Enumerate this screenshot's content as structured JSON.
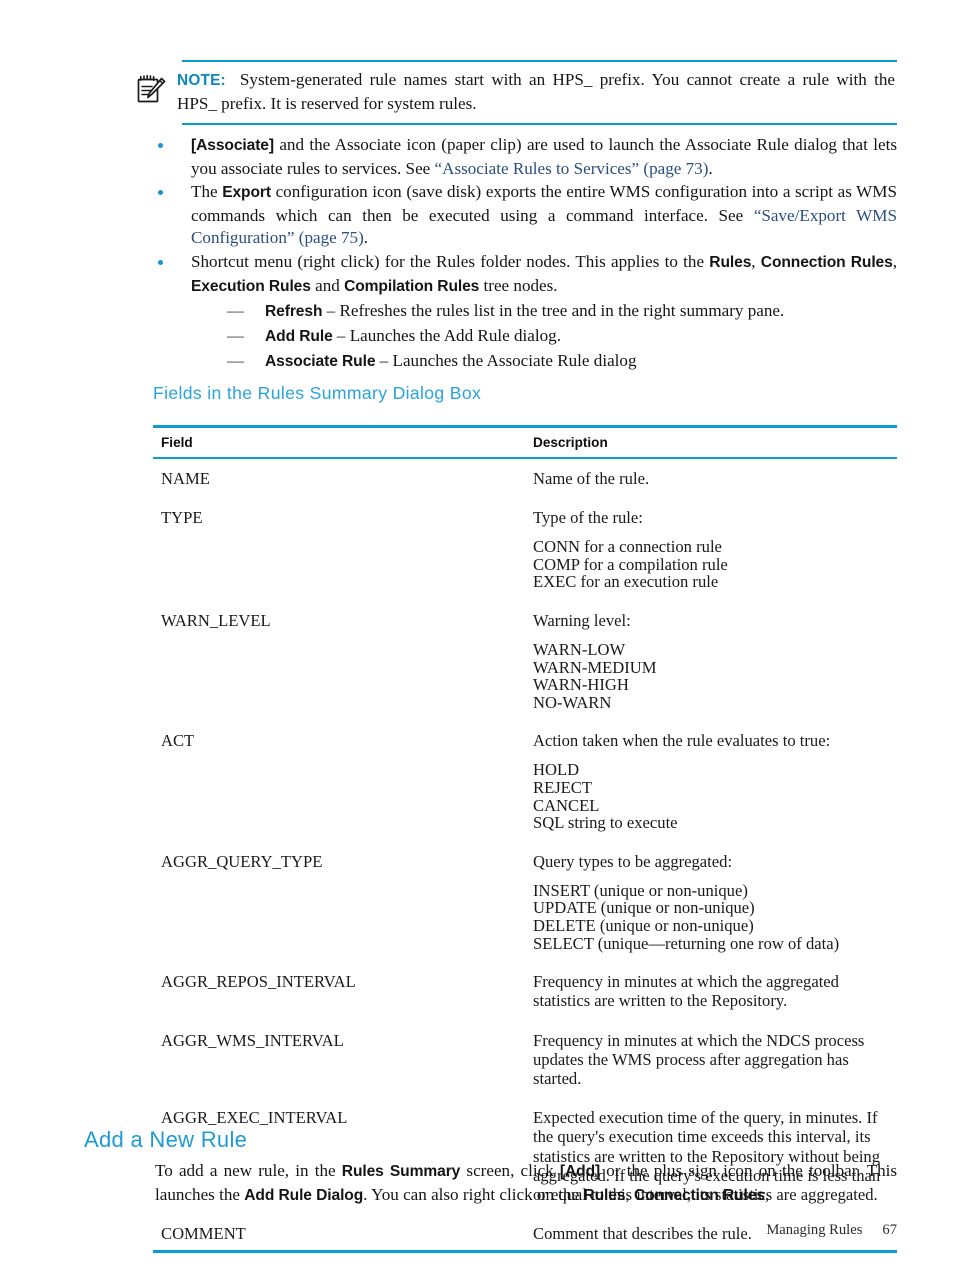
{
  "note": {
    "icon_name": "note-pad-pencil-icon",
    "label": "NOTE:",
    "text": "System-generated rule names start with an HPS_ prefix. You cannot create a rule with the HPS_ prefix. It is reserved for system rules."
  },
  "bullets": [
    {
      "id": "associate",
      "segments": [
        {
          "t": "[Associate]",
          "style": "bold"
        },
        {
          "t": " and the Associate icon (paper clip) are used to launch the Associate Rule dialog that lets you associate rules to services. See ",
          "style": "plain"
        },
        {
          "t": "“Associate Rules to Services” (page 73)",
          "style": "link"
        },
        {
          "t": ".",
          "style": "plain"
        }
      ]
    },
    {
      "id": "export",
      "segments": [
        {
          "t": "The ",
          "style": "plain"
        },
        {
          "t": "Export",
          "style": "bold"
        },
        {
          "t": " configuration icon (save disk) exports the entire WMS configuration into a script as WMS commands which can then be executed using a command interface. See ",
          "style": "plain"
        },
        {
          "t": "“Save/Export WMS Configuration” (page 75)",
          "style": "link"
        },
        {
          "t": ".",
          "style": "plain"
        }
      ]
    },
    {
      "id": "shortcut-menu",
      "segments": [
        {
          "t": "Shortcut menu (right click) for the Rules folder nodes. This applies to the ",
          "style": "plain"
        },
        {
          "t": "Rules",
          "style": "bold"
        },
        {
          "t": ", ",
          "style": "plain"
        },
        {
          "t": "Connection Rules",
          "style": "bold"
        },
        {
          "t": ", ",
          "style": "plain"
        },
        {
          "t": "Execution Rules",
          "style": "bold"
        },
        {
          "t": " and ",
          "style": "plain"
        },
        {
          "t": "Compilation Rules",
          "style": "bold"
        },
        {
          "t": " tree nodes.",
          "style": "plain"
        }
      ],
      "sub_items": [
        {
          "dash": "—",
          "segments": [
            {
              "t": "Refresh",
              "style": "bold"
            },
            {
              "t": " – Refreshes the rules list in the tree and in the right summary pane.",
              "style": "plain"
            }
          ]
        },
        {
          "dash": "—",
          "segments": [
            {
              "t": "Add Rule",
              "style": "bold"
            },
            {
              "t": " – Launches the Add Rule dialog.",
              "style": "plain"
            }
          ]
        },
        {
          "dash": "—",
          "segments": [
            {
              "t": "Associate Rule",
              "style": "bold"
            },
            {
              "t": " – Launches the Associate Rule dialog",
              "style": "plain"
            }
          ]
        }
      ]
    }
  ],
  "table": {
    "title": "Fields in the Rules Summary Dialog Box",
    "headers": [
      "Field",
      "Description"
    ],
    "rows": [
      {
        "field": "NAME",
        "lead": "Name of the rule.",
        "items": []
      },
      {
        "field": "TYPE",
        "lead": "Type of the rule:",
        "items": [
          "CONN for a connection rule",
          "COMP for a compilation rule",
          "EXEC for an execution rule"
        ]
      },
      {
        "field": "WARN_LEVEL",
        "lead": "Warning level:",
        "items": [
          "WARN-LOW",
          "WARN-MEDIUM",
          "WARN-HIGH",
          "NO-WARN"
        ]
      },
      {
        "field": "ACT",
        "lead": "Action taken when the rule evaluates to true:",
        "items": [
          "HOLD",
          "REJECT",
          "CANCEL",
          "SQL string to execute"
        ]
      },
      {
        "field": "AGGR_QUERY_TYPE",
        "lead": "Query types to be aggregated:",
        "items": [
          "INSERT (unique or non-unique)",
          "UPDATE (unique or non-unique)",
          "DELETE (unique or non-unique)",
          "SELECT (unique—returning one row of data)"
        ]
      },
      {
        "field": "AGGR_REPOS_INTERVAL",
        "lead": "Frequency in minutes at which the aggregated statistics are written to the Repository.",
        "items": []
      },
      {
        "field": "AGGR_WMS_INTERVAL",
        "lead": "Frequency in minutes at which the NDCS process updates the WMS process after aggregation has started.",
        "items": []
      },
      {
        "field": "AGGR_EXEC_INTERVAL",
        "lead": "Expected execution time of the query, in minutes. If the query's execution time exceeds this interval, its statistics are written to the Repository without being aggregated. If the query's execution time is less than or equal to this interval, its statistics are aggregated.",
        "items": []
      },
      {
        "field": "COMMENT",
        "lead": "Comment that describes the rule.",
        "items": []
      }
    ]
  },
  "section": {
    "heading": "Add a New Rule",
    "paragraph_segments": [
      {
        "t": "To add a new rule, in the ",
        "style": "plain"
      },
      {
        "t": "Rules Summary",
        "style": "bold"
      },
      {
        "t": " screen, click ",
        "style": "plain"
      },
      {
        "t": "[Add]",
        "style": "bold"
      },
      {
        "t": " or the plus sign icon on the toolbar. This launches the ",
        "style": "plain"
      },
      {
        "t": "Add Rule Dialog",
        "style": "bold"
      },
      {
        "t": ". You can also right click on the ",
        "style": "plain"
      },
      {
        "t": "Rules",
        "style": "bold"
      },
      {
        "t": ", ",
        "style": "plain"
      },
      {
        "t": "Connection Rules",
        "style": "bold"
      },
      {
        "t": ",",
        "style": "plain"
      }
    ]
  },
  "footer": {
    "chapter": "Managing Rules",
    "page_number": "67"
  },
  "colors": {
    "accent_blue": "#0b9dd0",
    "heading_blue": "#1e9ad6",
    "table_title_blue": "#29a3dd",
    "link_navy": "#2a4e7e",
    "bullet_blue": "#1496d2",
    "body_text": "#151515"
  }
}
